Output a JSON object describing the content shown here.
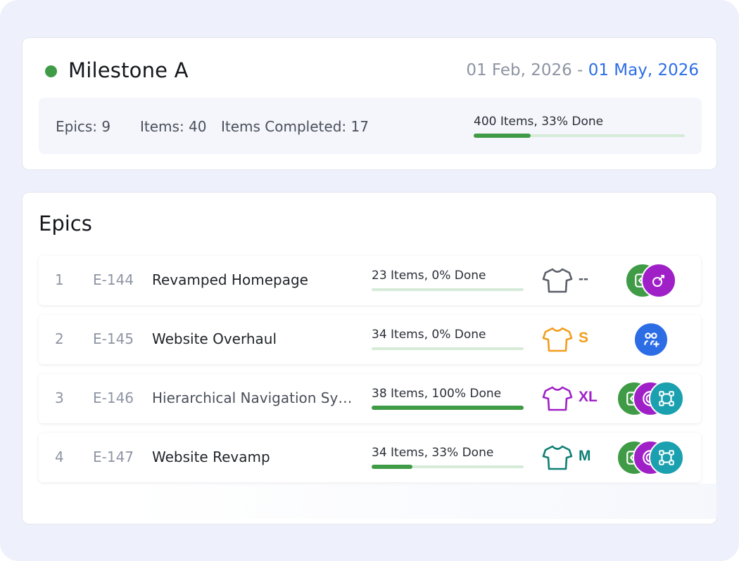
{
  "colors": {
    "green": "#3f9b46",
    "blue": "#2c6de6",
    "purple": "#a020c8",
    "teal": "#1aa0ae",
    "orange": "#f29d1d",
    "gray": "#5b5f67",
    "dark_teal": "#0f7f74"
  },
  "milestone": {
    "status_color": "#3f9b46",
    "title": "Milestone A",
    "start_date": "01 Feb, 2026",
    "separator": " - ",
    "end_date": "01 May, 2026",
    "stats": {
      "epics": "Epics: 9",
      "items": "Items: 40",
      "completed": "Items Completed: 17"
    },
    "progress": {
      "label": "400 Items, 33% Done",
      "fraction": 0.27
    }
  },
  "epics": {
    "title": "Epics",
    "rows": [
      {
        "number": "1",
        "key": "E-144",
        "name": "Revamped Homepage",
        "progress_label": "23 Items, 0% Done",
        "progress_fraction": 0,
        "shirt_icon": "tshirt-icon",
        "shirt_color": "#5b5f67",
        "size": "--",
        "size_color": "#5b5f67",
        "avatars": [
          "code-icon",
          "rocket-icon"
        ]
      },
      {
        "number": "2",
        "key": "E-145",
        "name": "Website Overhaul",
        "progress_label": "34 Items, 0% Done",
        "progress_fraction": 0,
        "shirt_icon": "tshirt-icon",
        "shirt_color": "#f29d1d",
        "size": "S",
        "size_color": "#f29d1d",
        "avatars": [
          "user-add-icon"
        ]
      },
      {
        "number": "3",
        "key": "E-146",
        "name": "Hierarchical Navigation System",
        "progress_label": "38 Items, 100% Done",
        "progress_fraction": 1,
        "shirt_icon": "tshirt-icon",
        "shirt_color": "#a020c8",
        "size": "XL",
        "size_color": "#a020c8",
        "avatars": [
          "code-icon",
          "target-icon",
          "vector-icon"
        ]
      },
      {
        "number": "4",
        "key": "E-147",
        "name": "Website Revamp",
        "progress_label": "34 Items, 33% Done",
        "progress_fraction": 0.27,
        "shirt_icon": "tshirt-icon",
        "shirt_color": "#0f7f74",
        "size": "M",
        "size_color": "#0f7f74",
        "avatars": [
          "code-icon",
          "target-icon",
          "vector-icon"
        ]
      }
    ]
  }
}
